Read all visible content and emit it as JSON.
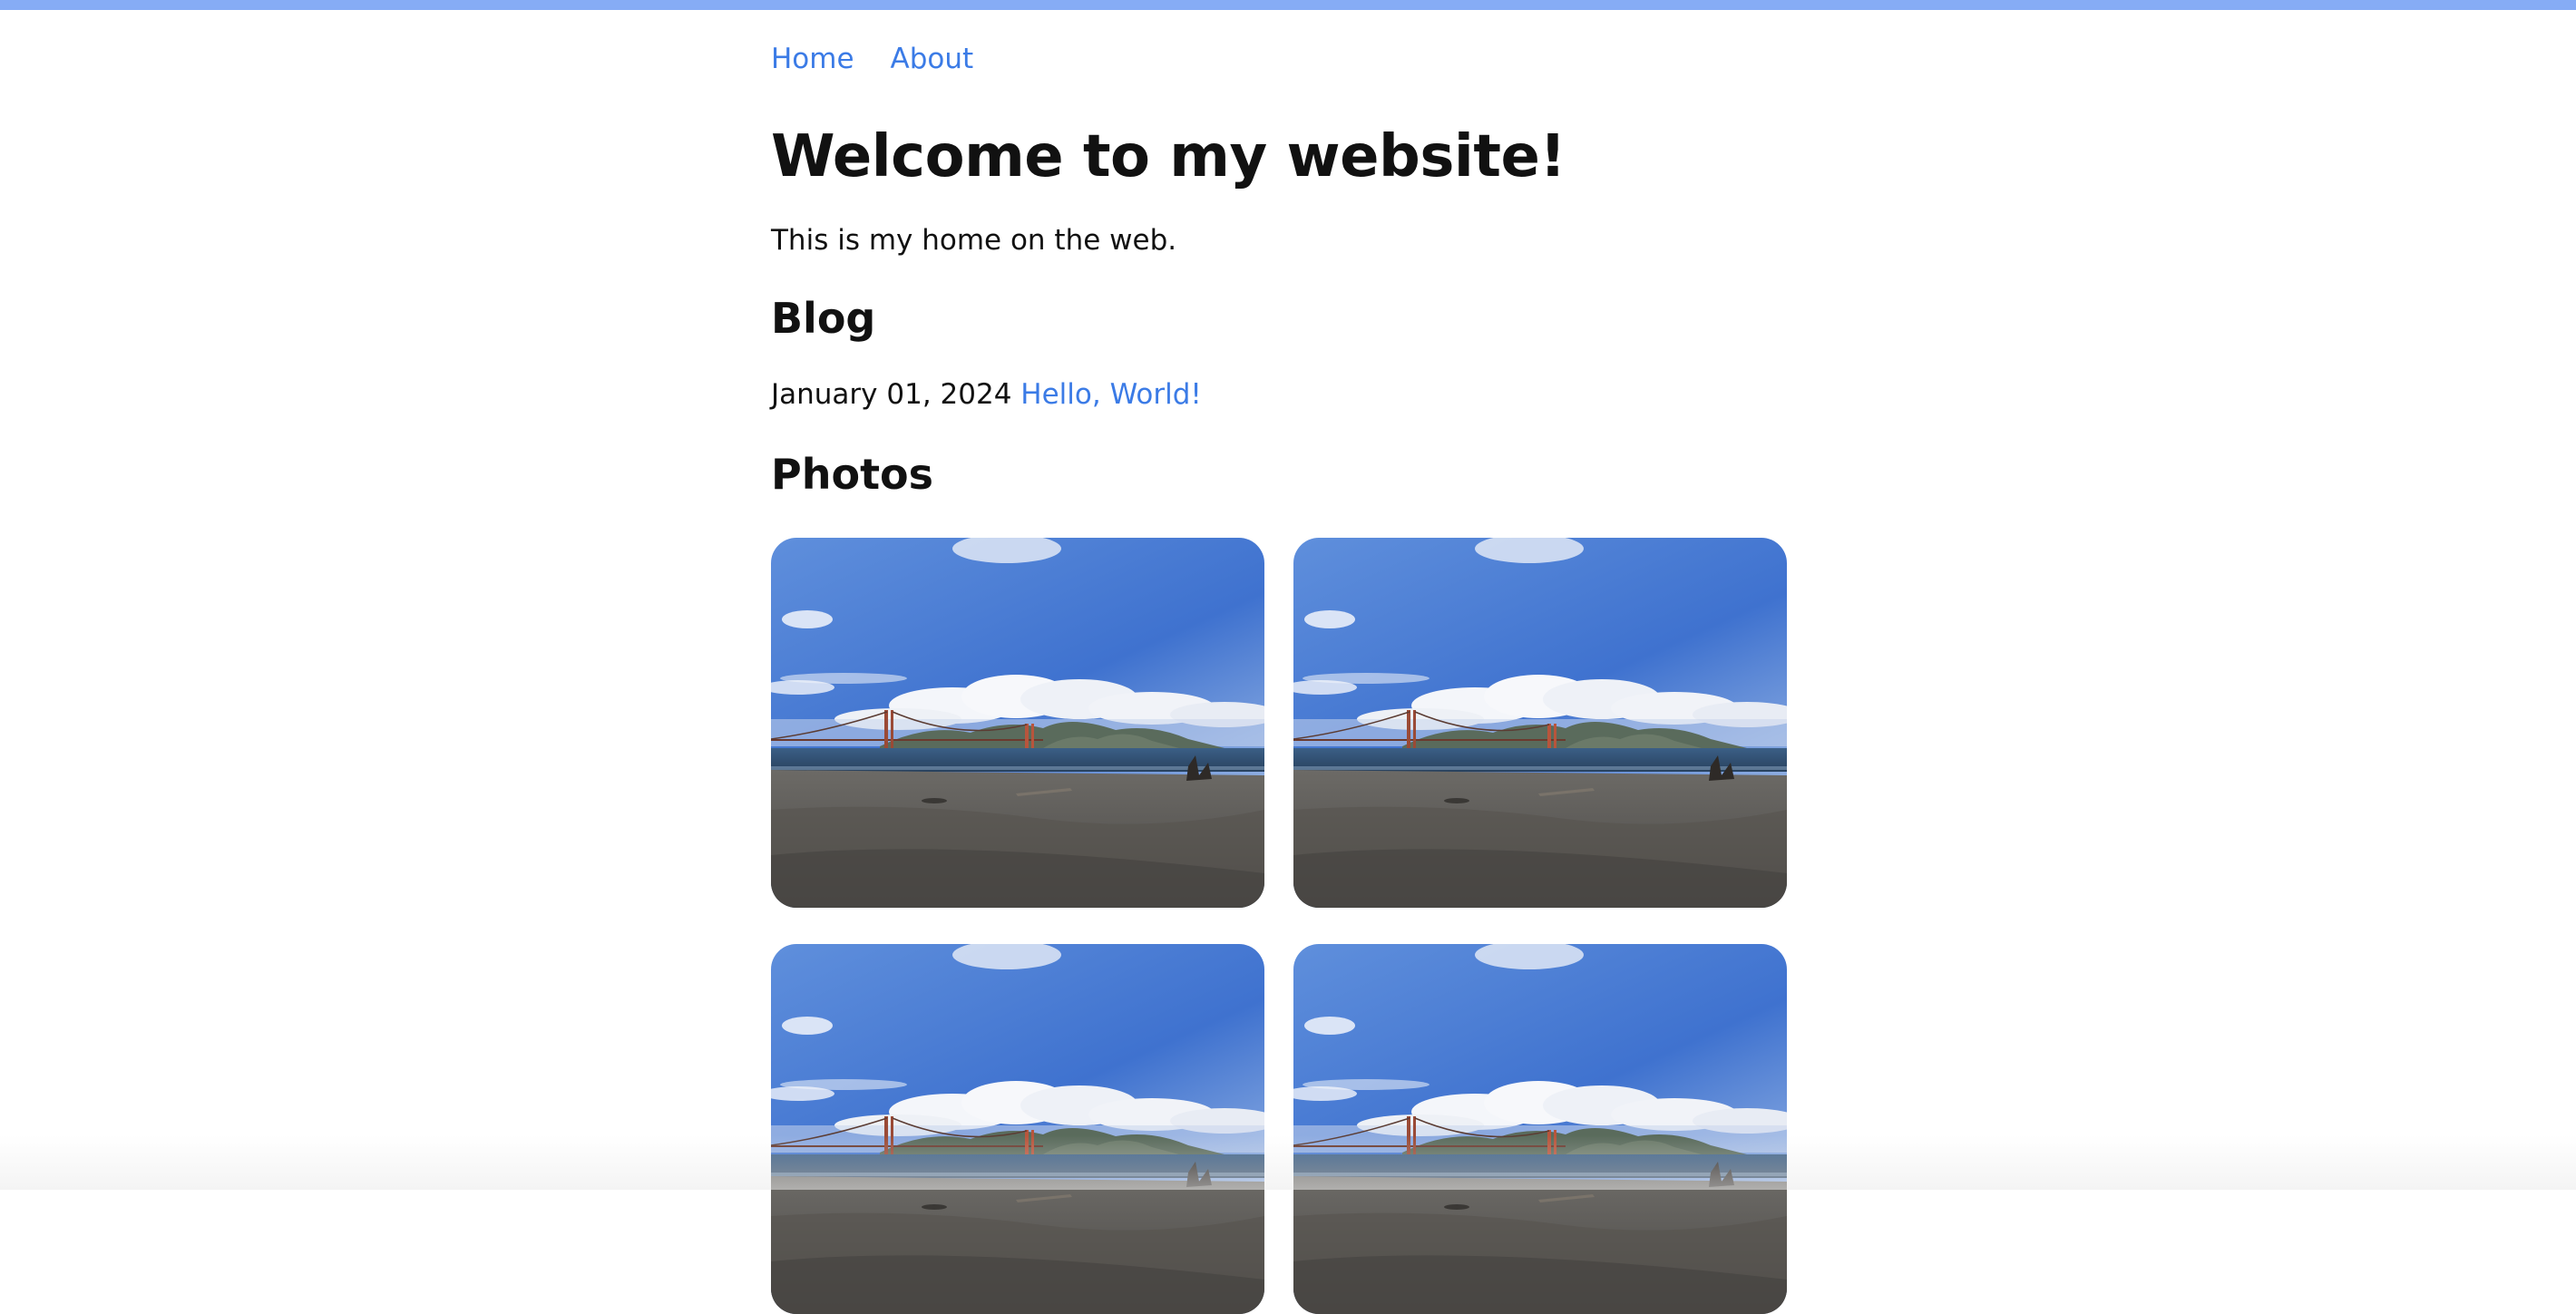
{
  "nav": {
    "items": [
      {
        "label": "Home"
      },
      {
        "label": "About"
      }
    ]
  },
  "header": {
    "title": "Welcome to my website!"
  },
  "intro": {
    "text": "This is my home on the web."
  },
  "blog": {
    "heading": "Blog",
    "posts": [
      {
        "date": "January 01, 2024",
        "title": "Hello, World!"
      }
    ]
  },
  "photos": {
    "heading": "Photos",
    "items": [
      {
        "subject": "beach-with-bridge-photo"
      },
      {
        "subject": "beach-with-bridge-photo"
      },
      {
        "subject": "beach-with-bridge-photo"
      },
      {
        "subject": "beach-with-bridge-photo"
      }
    ]
  },
  "colors": {
    "accent_bar": "#86acf5",
    "link": "#3b7be6",
    "text": "#111111"
  }
}
